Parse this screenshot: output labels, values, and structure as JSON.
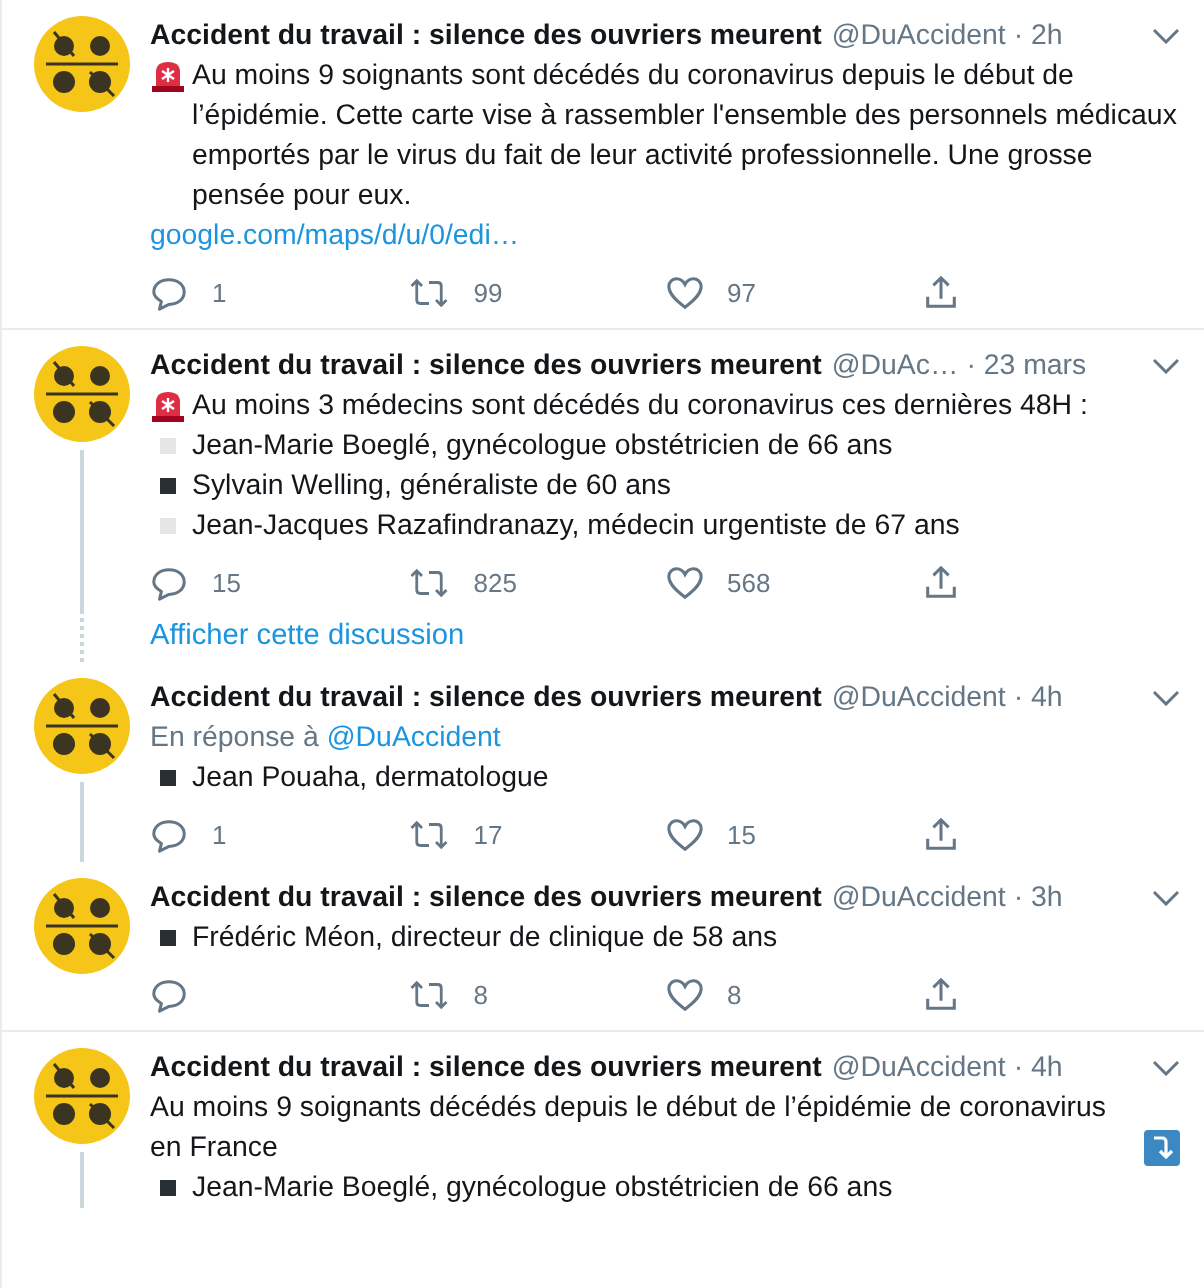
{
  "tweets": [
    {
      "name": "Accident du travail : silence des ouvriers meurent",
      "handle": "@DuAccident",
      "time": "· 2h",
      "thread_below": false,
      "body": [
        {
          "kind": "siren",
          "text": "Au moins 9 soignants sont décédés du coronavirus depuis le début de l’épidémie. Cette carte vise à rassembler l'ensemble des personnels médicaux emportés par le virus du fait de leur activité professionnelle. Une grosse pensée pour eux."
        },
        {
          "kind": "link",
          "text": "google.com/maps/d/u/0/edi…"
        }
      ],
      "actions": {
        "replies": "1",
        "retweets": "99",
        "likes": "97"
      }
    },
    {
      "name": "Accident du travail : silence des ouvriers meurent",
      "handle": "@DuAc…",
      "time": "· 23 mars",
      "thread_below": true,
      "body": [
        {
          "kind": "siren",
          "text": "Au moins 3 médecins sont décédés du coronavirus ces dernières 48H :"
        },
        {
          "kind": "bullet",
          "color": "#e6e6e6",
          "text": "Jean-Marie Boeglé, gynécologue obstétricien de 66 ans"
        },
        {
          "kind": "bullet",
          "color": "#292f33",
          "text": "Sylvain Welling, généraliste de 60 ans"
        },
        {
          "kind": "bullet",
          "color": "#e6e6e6",
          "text": "Jean-Jacques Razafindranazy, médecin urgentiste de 67 ans"
        }
      ],
      "actions": {
        "replies": "15",
        "retweets": "825",
        "likes": "568"
      },
      "show_thread": "Afficher cette discussion"
    },
    {
      "name": "Accident du travail : silence des ouvriers meurent",
      "handle": "@DuAccident",
      "time": "· 4h",
      "thread_below": true,
      "reply_label": "En réponse à",
      "reply_to": "@DuAccident",
      "body": [
        {
          "kind": "bullet",
          "color": "#292f33",
          "text": "Jean Pouaha, dermatologue"
        }
      ],
      "actions": {
        "replies": "1",
        "retweets": "17",
        "likes": "15"
      }
    },
    {
      "name": "Accident du travail : silence des ouvriers meurent",
      "handle": "@DuAccident",
      "time": "· 3h",
      "thread_below": false,
      "body": [
        {
          "kind": "bullet",
          "color": "#292f33",
          "text": "Frédéric Méon, directeur de clinique de 58 ans"
        }
      ],
      "actions": {
        "retweets": "8",
        "likes": "8"
      }
    },
    {
      "name": "Accident du travail : silence des ouvriers meurent",
      "handle": "@DuAccident",
      "time": "· 4h",
      "thread_below": true,
      "body": [
        {
          "kind": "arrow",
          "text": "Au moins 9 soignants décédés depuis le début de l’épidémie de coronavirus en France"
        },
        {
          "kind": "bullet",
          "color": "#292f33",
          "text": "Jean-Marie Boeglé, gynécologue obstétricien de 66 ans"
        }
      ]
    }
  ]
}
